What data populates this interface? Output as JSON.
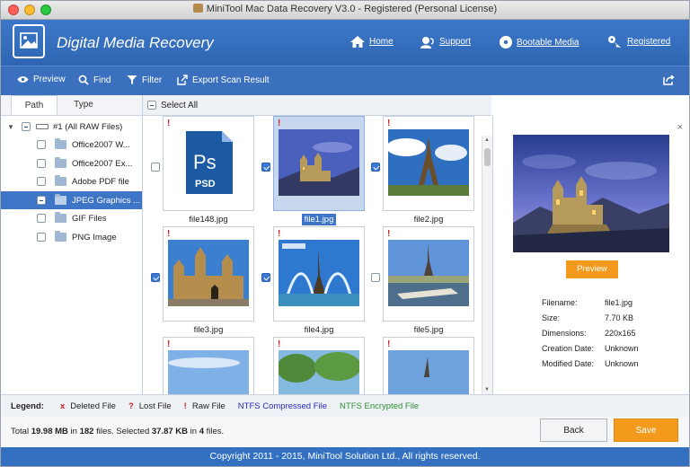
{
  "window": {
    "title": "MiniTool Mac Data Recovery V3.0 - Registered (Personal License)"
  },
  "header": {
    "app_title": "Digital Media Recovery",
    "nav": [
      {
        "label": "Home",
        "icon": "home-icon"
      },
      {
        "label": "Support",
        "icon": "support-icon"
      },
      {
        "label": "Bootable Media",
        "icon": "disc-icon"
      },
      {
        "label": "Registered",
        "icon": "key-icon"
      }
    ]
  },
  "toolbar": {
    "preview_label": "Preview",
    "find_label": "Find",
    "filter_label": "Filter",
    "export_label": "Export Scan Result"
  },
  "left": {
    "tabs": [
      {
        "label": "Path"
      },
      {
        "label": "Type"
      }
    ],
    "root_label": "#1 (All RAW Files)",
    "items": [
      {
        "label": "Office2007 W...",
        "state": "unchecked"
      },
      {
        "label": "Office2007 Ex...",
        "state": "unchecked"
      },
      {
        "label": "Adobe PDF file",
        "state": "unchecked"
      },
      {
        "label": "JPEG Graphics ...",
        "state": "partial"
      },
      {
        "label": "GIF Files",
        "state": "unchecked"
      },
      {
        "label": "PNG Image",
        "state": "unchecked"
      }
    ]
  },
  "center": {
    "select_all_label": "Select All",
    "files": [
      {
        "name": "file148.jpg",
        "checked": false,
        "selected": false,
        "kind": "psd",
        "psd_label": "PSD",
        "ps_label": "Ps"
      },
      {
        "name": "file1.jpg",
        "checked": true,
        "selected": true,
        "kind": "castle"
      },
      {
        "name": "file2.jpg",
        "checked": true,
        "selected": false,
        "kind": "eiffel"
      },
      {
        "name": "file3.jpg",
        "checked": true,
        "selected": false,
        "kind": "parliament"
      },
      {
        "name": "file4.jpg",
        "checked": true,
        "selected": false,
        "kind": "fountain"
      },
      {
        "name": "file5.jpg",
        "checked": false,
        "selected": false,
        "kind": "river"
      },
      {
        "name": "",
        "checked": false,
        "selected": false,
        "kind": "sky"
      },
      {
        "name": "",
        "checked": false,
        "selected": false,
        "kind": "trees"
      },
      {
        "name": "",
        "checked": false,
        "selected": false,
        "kind": "tower"
      }
    ]
  },
  "preview": {
    "button_label": "Preview",
    "fields": [
      {
        "key": "Filename:",
        "value": "file1.jpg"
      },
      {
        "key": "Size:",
        "value": "7.70 KB"
      },
      {
        "key": "Dimensions:",
        "value": "220x165"
      },
      {
        "key": "Creation Date:",
        "value": "Unknown"
      },
      {
        "key": "Modified Date:",
        "value": "Unknown"
      }
    ]
  },
  "legend": {
    "title": "Legend:",
    "deleted": {
      "mark": "x",
      "label": "Deleted File"
    },
    "lost": {
      "mark": "?",
      "label": "Lost File"
    },
    "raw": {
      "mark": "!",
      "label": "Raw File"
    },
    "ntfs_compressed": "NTFS Compressed File",
    "ntfs_encrypted": "NTFS Encrypted File",
    "colors": {
      "deleted": "#d21f1f",
      "ntfs_compressed": "#2a2ab8",
      "ntfs_encrypted": "#2f8f2f"
    }
  },
  "status": {
    "total_prefix": "Total",
    "total_size": "19.98 MB",
    "in_label": "in",
    "total_files": "182",
    "files_label": "files.  Selected",
    "selected_size": "37.87 KB",
    "in_label2": "in",
    "selected_files": "4",
    "files_label2": "files."
  },
  "buttons": {
    "back": "Back",
    "save": "Save"
  },
  "footer": {
    "copyright": "Copyright 2011 - 2015, MiniTool Solution Ltd., All rights reserved."
  }
}
